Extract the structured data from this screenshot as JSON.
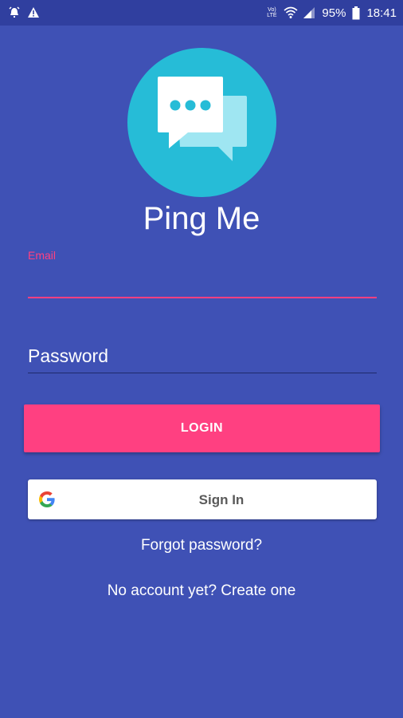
{
  "status_bar": {
    "left_icons": [
      "alarm-icon",
      "warning-icon"
    ],
    "network_label": "Vo) LTE",
    "battery_percent": "95%",
    "time": "18:41"
  },
  "app": {
    "title": "Ping Me",
    "logo_icon": "chat-bubbles-icon"
  },
  "form": {
    "email_label": "Email",
    "email_value": "",
    "password_placeholder": "Password",
    "login_label": "LOGIN",
    "google_label": "Sign In",
    "forgot_label": "Forgot password?",
    "create_label": "No account yet? Create one"
  },
  "colors": {
    "background": "#3f51b5",
    "status_bar": "#303f9f",
    "accent": "#ff4081",
    "logo_circle": "#26bcd7"
  }
}
